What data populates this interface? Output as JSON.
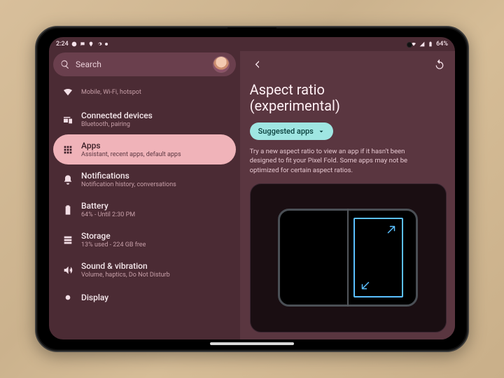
{
  "status": {
    "time": "2:24",
    "battery_text": "64%"
  },
  "search": {
    "placeholder": "Search"
  },
  "left_items": [
    {
      "id": "truncated",
      "title": "",
      "sub": "Mobile, Wi‑Fi, hotspot",
      "icon": "wifi"
    },
    {
      "id": "connected",
      "title": "Connected devices",
      "sub": "Bluetooth, pairing",
      "icon": "devices"
    },
    {
      "id": "apps",
      "title": "Apps",
      "sub": "Assistant, recent apps, default apps",
      "icon": "grid",
      "selected": true
    },
    {
      "id": "notif",
      "title": "Notifications",
      "sub": "Notification history, conversations",
      "icon": "bell"
    },
    {
      "id": "battery",
      "title": "Battery",
      "sub": "64% ‑ Until 2:30 PM",
      "icon": "battery"
    },
    {
      "id": "storage",
      "title": "Storage",
      "sub": "13% used ‑ 224 GB free",
      "icon": "storage"
    },
    {
      "id": "sound",
      "title": "Sound & vibration",
      "sub": "Volume, haptics, Do Not Disturb",
      "icon": "volume"
    },
    {
      "id": "display",
      "title": "Display",
      "sub": "",
      "icon": "brightness"
    }
  ],
  "right_panel": {
    "title_line1": "Aspect ratio",
    "title_line2": "(experimental)",
    "chip_label": "Suggested apps",
    "description": "Try a new aspect ratio to view an app if it hasn't been designed to fit your Pixel Fold. Some apps may not be optimized for certain aspect ratios."
  }
}
